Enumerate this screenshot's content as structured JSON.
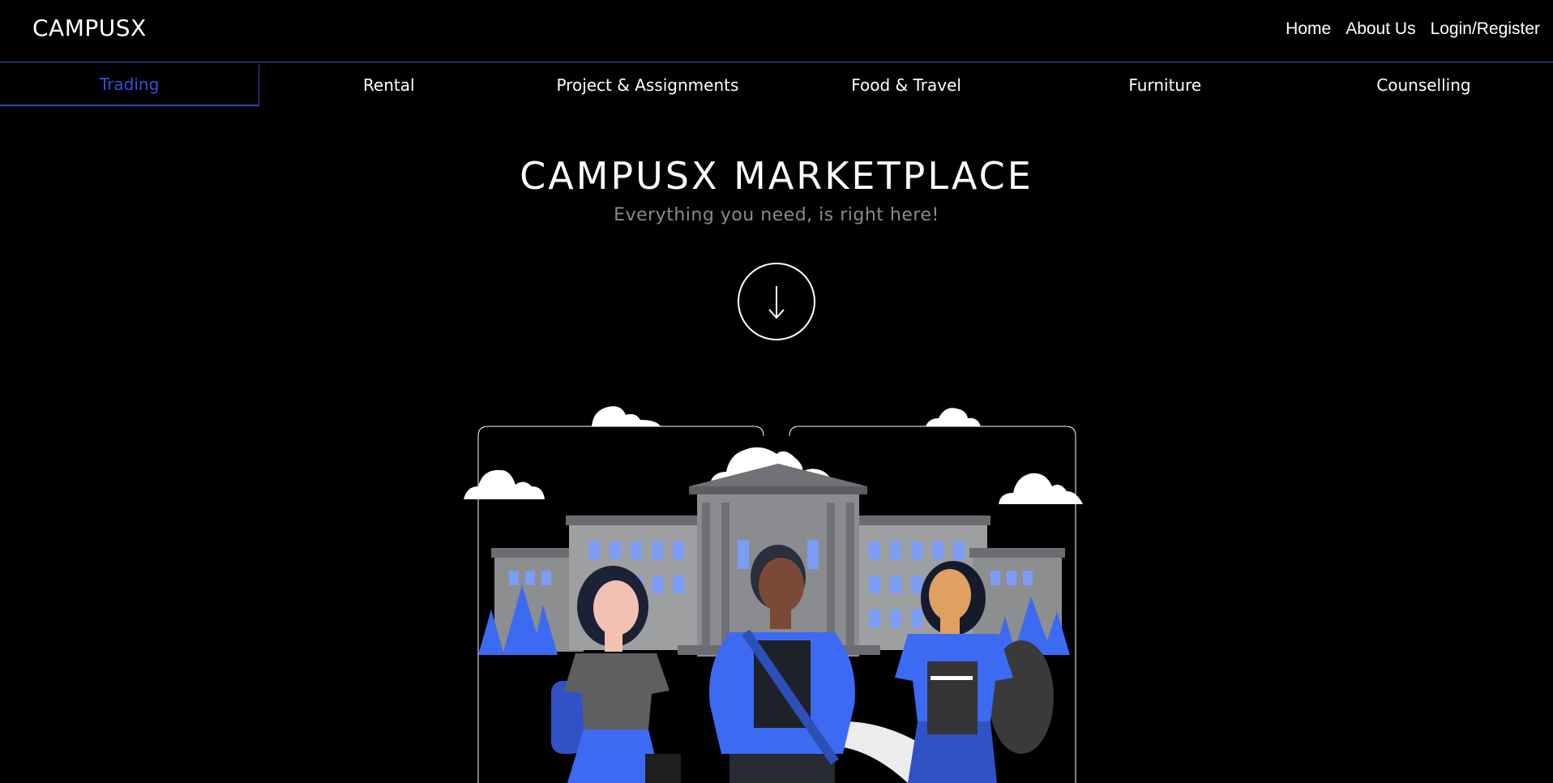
{
  "header": {
    "brand": "CAMPUSX",
    "nav": [
      {
        "label": "Home"
      },
      {
        "label": "About Us"
      },
      {
        "label": "Login/Register"
      }
    ]
  },
  "tabs": [
    {
      "label": "Trading",
      "active": true
    },
    {
      "label": "Rental",
      "active": false
    },
    {
      "label": "Project & Assignments",
      "active": false
    },
    {
      "label": "Food & Travel",
      "active": false
    },
    {
      "label": "Furniture",
      "active": false
    },
    {
      "label": "Counselling",
      "active": false
    }
  ],
  "hero": {
    "title": "CAMPUSX MARKETPLACE",
    "subtitle": "Everything you need, is right here!",
    "scroll_icon": "arrow-down-icon"
  },
  "illustration": {
    "subject": "campus-students-illustration"
  },
  "colors": {
    "background": "#000000",
    "accent": "#3552d6",
    "text": "#ffffff",
    "muted": "#8a8a8a",
    "building": "#8c8e90",
    "student_blue": "#3d6af2"
  }
}
